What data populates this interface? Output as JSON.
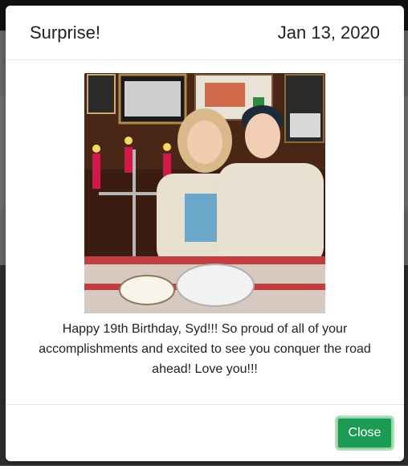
{
  "modal": {
    "title": "Surprise!",
    "date": "Jan 13, 2020",
    "photo_alt": "Couple seated at a restaurant table with candles",
    "message": "Happy 19th Birthday, Syd!!! So proud of all of your accomplishments and excited to see you conquer the road ahead! Love you!!!",
    "close_label": "Close"
  },
  "colors": {
    "close_button": "#1e9b52",
    "header_border": "#e3e3e3"
  }
}
